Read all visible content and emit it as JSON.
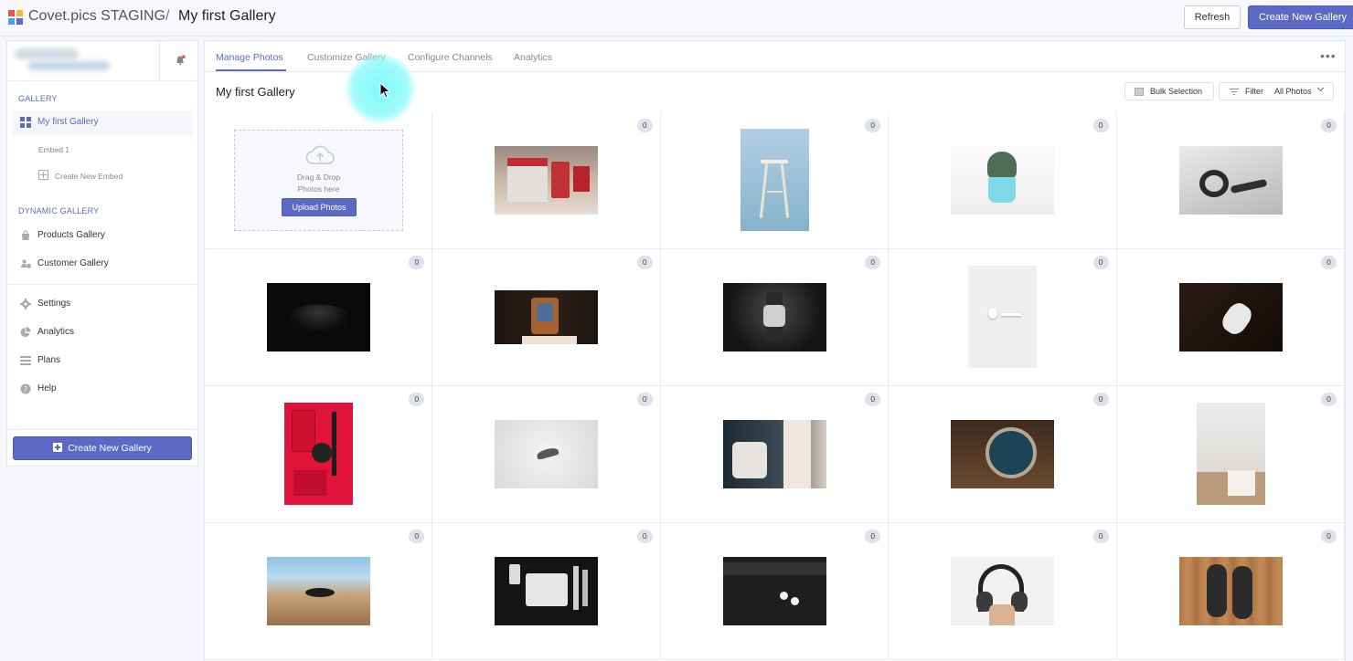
{
  "header": {
    "app_title": "Covet.pics STAGING",
    "separator": "/",
    "page_title": "My first Gallery",
    "refresh_label": "Refresh",
    "create_label": "Create New Gallery",
    "accent_color": "#5c6ac4"
  },
  "sidebar": {
    "gallery_heading": "GALLERY",
    "gallery_item": "My first Gallery",
    "embed_item": "Embed 1",
    "create_embed": "Create New Embed",
    "dynamic_heading": "DYNAMIC GALLERY",
    "products_item": "Products Gallery",
    "customer_item": "Customer Gallery",
    "settings_item": "Settings",
    "analytics_item": "Analytics",
    "plans_item": "Plans",
    "help_item": "Help",
    "create_button": "Create New Gallery"
  },
  "tabs": {
    "manage": "Manage Photos",
    "customize": "Customize Gallery",
    "channels": "Configure Channels",
    "analytics": "Analytics",
    "more": "•••"
  },
  "toolbar": {
    "title": "My first Gallery",
    "bulk_label": "Bulk Selection",
    "filter_label": "Filter",
    "filter_value": "All Photos"
  },
  "upload": {
    "drag_line1": "Drag & Drop",
    "drag_line2": "Photos here",
    "button": "Upload Photos"
  },
  "photo_count": "0"
}
